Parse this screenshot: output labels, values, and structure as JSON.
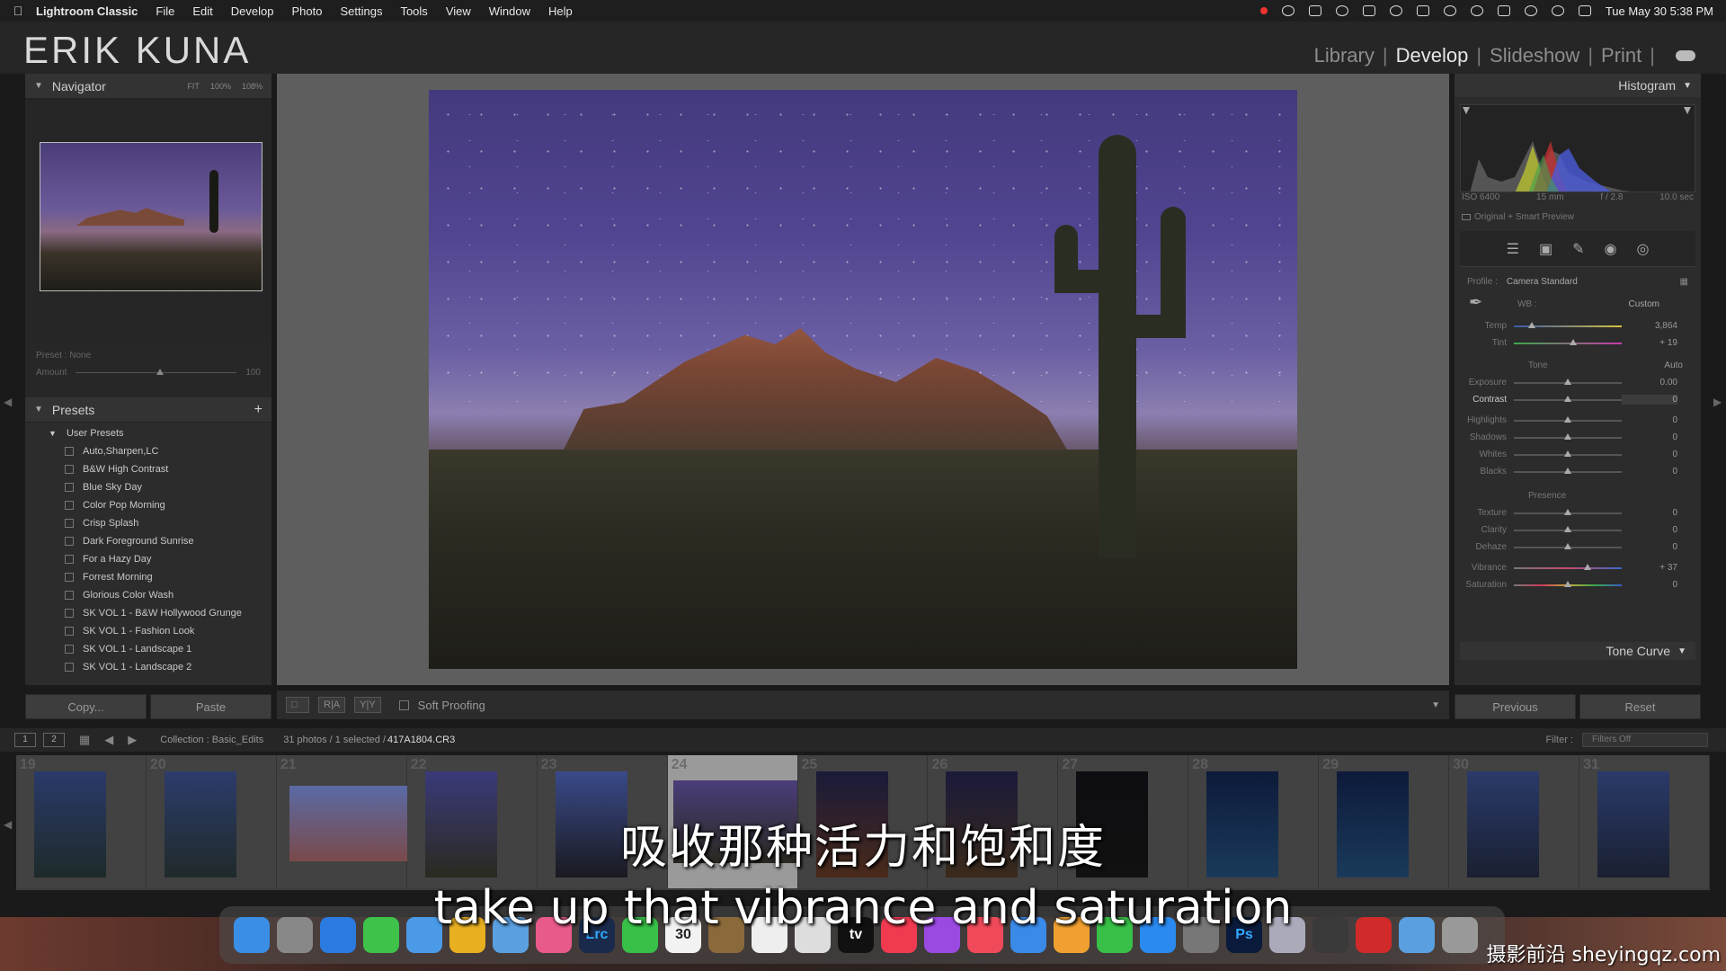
{
  "menubar": {
    "app_name": "Lightroom Classic",
    "menus": [
      "File",
      "Edit",
      "Develop",
      "Photo",
      "Settings",
      "Tools",
      "View",
      "Window",
      "Help"
    ],
    "clock": "Tue May 30  5:38 PM"
  },
  "header": {
    "identity_plate": "ERIK KUNA",
    "modules": [
      "Library",
      "Develop",
      "Slideshow",
      "Print"
    ],
    "active_module": "Develop"
  },
  "left_panel": {
    "navigator": {
      "title": "Navigator",
      "zoom_options": [
        "FIT",
        "100%",
        "108%"
      ]
    },
    "preset_amount": {
      "preset_label": "Preset : None",
      "amount_label": "Amount",
      "amount_value": "100",
      "amount_fraction": 0.5
    },
    "presets": {
      "title": "Presets",
      "folder": "User Presets",
      "items": [
        "Auto,Sharpen,LC",
        "B&W High Contrast",
        "Blue Sky Day",
        "Color Pop Morning",
        "Crisp Splash",
        "Dark Foreground Sunrise",
        "For a Hazy Day",
        "Forrest Morning",
        "Glorious Color Wash",
        "SK VOL 1 - B&W Hollywood Grunge",
        "SK VOL 1 - Fashion Look",
        "SK VOL 1 - Landscape 1",
        "SK VOL 1 - Landscape 2"
      ]
    },
    "copy_label": "Copy...",
    "paste_label": "Paste"
  },
  "toolbar": {
    "soft_proofing": "Soft Proofing",
    "ra_label": "R|A",
    "yy_label": "Y|Y"
  },
  "right_panel": {
    "histogram": {
      "title": "Histogram",
      "iso": "ISO 6400",
      "focal": "15 mm",
      "aperture": "f / 2.8",
      "shutter": "10.0 sec",
      "preview_label": "Original + Smart Preview"
    },
    "profile": {
      "label": "Profile :",
      "value": "Camera Standard"
    },
    "wb": {
      "label": "WB :",
      "value": "Custom"
    },
    "tone_label": "Tone",
    "auto_label": "Auto",
    "presence_label": "Presence",
    "sliders": {
      "temp": {
        "label": "Temp",
        "value": "3,864",
        "pos": 0.17
      },
      "tint": {
        "label": "Tint",
        "value": "+ 19",
        "pos": 0.55
      },
      "exposure": {
        "label": "Exposure",
        "value": "0.00",
        "pos": 0.5
      },
      "contrast": {
        "label": "Contrast",
        "value": "0",
        "pos": 0.5
      },
      "highlights": {
        "label": "Highlights",
        "value": "0",
        "pos": 0.5
      },
      "shadows": {
        "label": "Shadows",
        "value": "0",
        "pos": 0.5
      },
      "whites": {
        "label": "Whites",
        "value": "0",
        "pos": 0.5
      },
      "blacks": {
        "label": "Blacks",
        "value": "0",
        "pos": 0.5
      },
      "texture": {
        "label": "Texture",
        "value": "0",
        "pos": 0.5
      },
      "clarity": {
        "label": "Clarity",
        "value": "0",
        "pos": 0.5
      },
      "dehaze": {
        "label": "Dehaze",
        "value": "0",
        "pos": 0.5
      },
      "vibrance": {
        "label": "Vibrance",
        "value": "+ 37",
        "pos": 0.68
      },
      "saturation": {
        "label": "Saturation",
        "value": "0",
        "pos": 0.5
      }
    },
    "tone_curve_label": "Tone Curve",
    "previous_label": "Previous",
    "reset_label": "Reset"
  },
  "filmstrip": {
    "views": [
      "1",
      "2"
    ],
    "collection": "Collection : Basic_Edits",
    "count": "31 photos / 1 selected /",
    "filename": "417A1804.CR3",
    "filter_label": "Filter :",
    "filter_value": "Filters Off",
    "cells": [
      {
        "n": "19",
        "c1": "#2a3a6a",
        "c2": "#1e2a2a"
      },
      {
        "n": "20",
        "c1": "#2c3c6c",
        "c2": "#202a2a"
      },
      {
        "n": "21",
        "c1": "#5a6aa6",
        "c2": "#7a4a4a",
        "wide": true
      },
      {
        "n": "22",
        "c1": "#3a3a7a",
        "c2": "#2a2a20"
      },
      {
        "n": "23",
        "c1": "#3a4a8a",
        "c2": "#1a1a20"
      },
      {
        "n": "24",
        "c1": "#4b3d7a",
        "c2": "#2a2820",
        "wide2": true,
        "sel": true
      },
      {
        "n": "25",
        "c1": "#1a1a3a",
        "c2": "#4a2a1a"
      },
      {
        "n": "26",
        "c1": "#1a1a3a",
        "c2": "#3a2a1a"
      },
      {
        "n": "27",
        "c1": "#0e0e12",
        "c2": "#111"
      },
      {
        "n": "28",
        "c1": "#0e1a3a",
        "c2": "#1a3a5a"
      },
      {
        "n": "29",
        "c1": "#0e1a3a",
        "c2": "#1a3a5a"
      },
      {
        "n": "30",
        "c1": "#2a3a6a",
        "c2": "#1a2030"
      },
      {
        "n": "31",
        "c1": "#2a3a6a",
        "c2": "#1a2030"
      }
    ]
  },
  "subtitles": {
    "chinese": "吸收那种活力和饱和度",
    "english": "take up that vibrance and saturation"
  },
  "dock": {
    "icons": [
      {
        "name": "finder-icon",
        "color": "#3a8ee6",
        "label": ""
      },
      {
        "name": "launchpad-icon",
        "color": "#888",
        "label": ""
      },
      {
        "name": "safari-icon",
        "color": "#2a7ae0",
        "label": ""
      },
      {
        "name": "messages-icon",
        "color": "#3ec24a",
        "label": ""
      },
      {
        "name": "mail-icon",
        "color": "#4a9ae8",
        "label": ""
      },
      {
        "name": "chrome-icon",
        "color": "#e8b020",
        "label": ""
      },
      {
        "name": "maps-icon",
        "color": "#5aa0e0",
        "label": ""
      },
      {
        "name": "photos-icon",
        "color": "#e85a8a",
        "label": ""
      },
      {
        "name": "lightroom-icon",
        "color": "#1a2a4a",
        "label": "Lrc"
      },
      {
        "name": "facetime-icon",
        "color": "#38c048",
        "label": ""
      },
      {
        "name": "calendar-icon",
        "color": "#f2f2f2",
        "label": "30"
      },
      {
        "name": "notes-folder-icon",
        "color": "#8a6a3a",
        "label": ""
      },
      {
        "name": "reminders-icon",
        "color": "#eee",
        "label": ""
      },
      {
        "name": "files-icon",
        "color": "#ddd",
        "label": ""
      },
      {
        "name": "appletv-icon",
        "color": "#111",
        "label": "tv"
      },
      {
        "name": "music-icon",
        "color": "#f03a50",
        "label": ""
      },
      {
        "name": "podcasts-icon",
        "color": "#9a4ae0",
        "label": ""
      },
      {
        "name": "news-icon",
        "color": "#f04a5a",
        "label": ""
      },
      {
        "name": "keynote-icon",
        "color": "#3a8ae8",
        "label": ""
      },
      {
        "name": "pages-icon",
        "color": "#f0a030",
        "label": ""
      },
      {
        "name": "numbers-icon",
        "color": "#38c048",
        "label": ""
      },
      {
        "name": "appstore-icon",
        "color": "#2a8af0",
        "label": ""
      },
      {
        "name": "system-settings-icon",
        "color": "#777",
        "label": ""
      },
      {
        "name": "photoshop-icon",
        "color": "#0a1a3a",
        "label": "Ps"
      },
      {
        "name": "preview-icon",
        "color": "#aab",
        "label": ""
      },
      {
        "name": "drive-icon",
        "color": "#3a3a3a",
        "label": ""
      },
      {
        "name": "acrobat-icon",
        "color": "#d02a2a",
        "label": ""
      },
      {
        "name": "folder-icon",
        "color": "#5aa0e0",
        "label": ""
      },
      {
        "name": "trash-icon",
        "color": "#999",
        "label": ""
      }
    ]
  },
  "watermark": "摄影前沿 sheyingqz.com"
}
